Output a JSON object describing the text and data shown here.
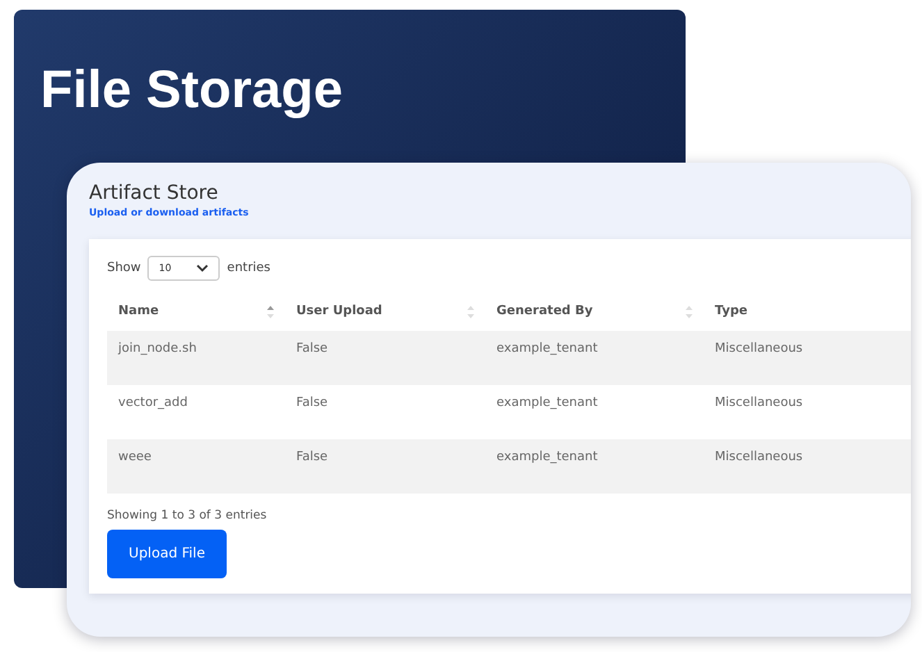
{
  "hero": {
    "title": "File Storage"
  },
  "card": {
    "title": "Artifact Store",
    "subtitle": "Upload or download artifacts"
  },
  "length_control": {
    "before": "Show",
    "value": "10",
    "after": "entries"
  },
  "table": {
    "columns": [
      "Name",
      "User Upload",
      "Generated By",
      "Type"
    ],
    "rows": [
      [
        "join_node.sh",
        "False",
        "example_tenant",
        "Miscellaneous"
      ],
      [
        "vector_add",
        "False",
        "example_tenant",
        "Miscellaneous"
      ],
      [
        "weee",
        "False",
        "example_tenant",
        "Miscellaneous"
      ]
    ]
  },
  "info": "Showing 1 to 3 of 3 entries",
  "upload_button": "Upload File"
}
